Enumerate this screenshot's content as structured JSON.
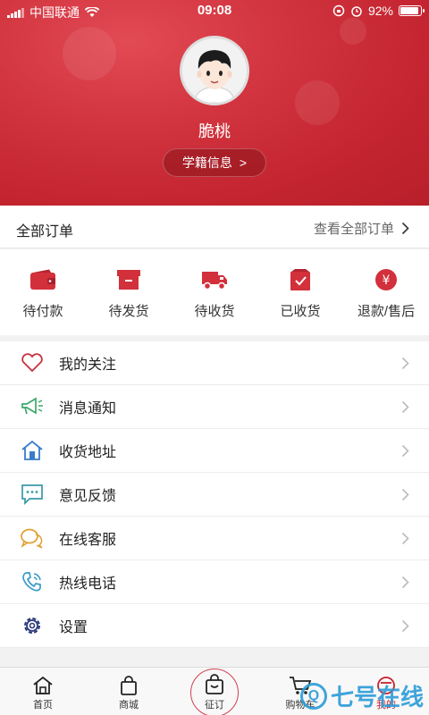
{
  "status_bar": {
    "carrier": "中国联通",
    "time": "09:08",
    "battery_text": "92%",
    "battery_level": 0.92
  },
  "profile": {
    "username": "脆桃",
    "student_info_label": "学籍信息",
    "student_info_arrow": ">"
  },
  "orders": {
    "title": "全部订单",
    "view_all": "查看全部订单",
    "items": [
      {
        "label": "待付款",
        "icon": "wallet-icon"
      },
      {
        "label": "待发货",
        "icon": "box-icon"
      },
      {
        "label": "待收货",
        "icon": "truck-icon"
      },
      {
        "label": "已收货",
        "icon": "received-box-icon"
      },
      {
        "label": "退款/售后",
        "icon": "yen-icon"
      }
    ]
  },
  "menu": {
    "items": [
      {
        "label": "我的关注",
        "icon": "heart-icon"
      },
      {
        "label": "消息通知",
        "icon": "megaphone-icon"
      },
      {
        "label": "收货地址",
        "icon": "house-icon"
      },
      {
        "label": "意见反馈",
        "icon": "chat-bubble-icon"
      },
      {
        "label": "在线客服",
        "icon": "chat-bubbles-icon"
      },
      {
        "label": "热线电话",
        "icon": "phone-icon"
      },
      {
        "label": "设置",
        "icon": "gear-icon"
      }
    ]
  },
  "tabbar": {
    "tabs": [
      {
        "label": "首页",
        "icon": "home-icon"
      },
      {
        "label": "商城",
        "icon": "shopping-bag-icon"
      },
      {
        "label": "征订",
        "icon": "subscribe-bag-icon"
      },
      {
        "label": "购物车",
        "icon": "cart-icon"
      },
      {
        "label": "我的",
        "icon": "profile-icon"
      }
    ]
  },
  "watermark": {
    "text": "七号在线"
  },
  "colors": {
    "brand_red": "#c8202e",
    "order_icon_red": "#d2303b"
  }
}
